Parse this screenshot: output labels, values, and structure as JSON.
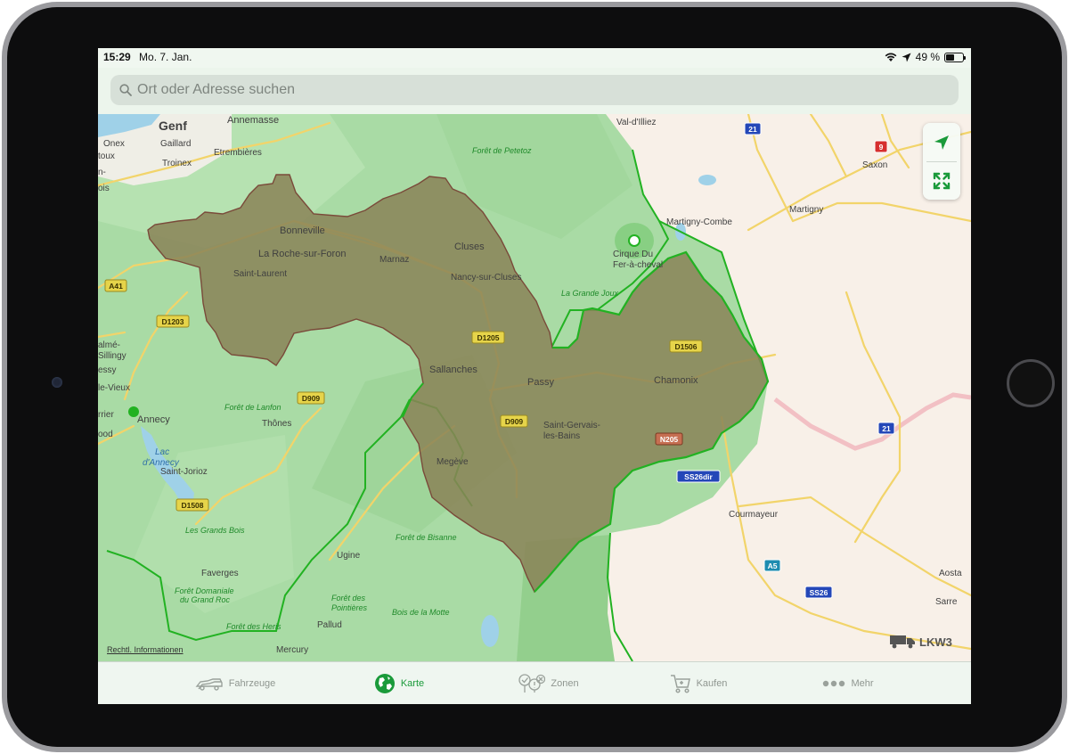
{
  "status": {
    "time": "15:29",
    "date": "Mo. 7. Jan.",
    "battery": "49 %",
    "battery_level": 0.49
  },
  "search": {
    "placeholder": "Ort oder Adresse suchen",
    "value": ""
  },
  "map": {
    "zone_fill": "#8a8257",
    "zone_stroke": "#7a4a3a",
    "border_green": "#22b222",
    "france_fill": "#a9dba5",
    "foreign_fill": "#f8f0e8",
    "cities": [
      {
        "name": "Genf"
      },
      {
        "name": "Annemasse"
      },
      {
        "name": "Onex"
      },
      {
        "name": "Gaillard"
      },
      {
        "name": "Troinex"
      },
      {
        "name": "Etrembières"
      },
      {
        "name": "Bonneville"
      },
      {
        "name": "La Roche-sur-Foron"
      },
      {
        "name": "Marnaz"
      },
      {
        "name": "Cluses"
      },
      {
        "name": "Saint-Laurent"
      },
      {
        "name": "Nancy-sur-Cluses"
      },
      {
        "name": "Sallanches"
      },
      {
        "name": "Passy"
      },
      {
        "name": "Chamonix"
      },
      {
        "name": "Saint-Gervais-"
      },
      {
        "name": "les-Bains"
      },
      {
        "name": "Megève"
      },
      {
        "name": "Annecy"
      },
      {
        "name": "Thônes"
      },
      {
        "name": "Saint-Jorioz"
      },
      {
        "name": "Faverges"
      },
      {
        "name": "Ugine"
      },
      {
        "name": "Pallud"
      },
      {
        "name": "Mercury"
      },
      {
        "name": "Val-d'Illiez"
      },
      {
        "name": "Saxon"
      },
      {
        "name": "Martigny"
      },
      {
        "name": "Martigny-Combe"
      },
      {
        "name": "Courmayeur"
      },
      {
        "name": "Aosta"
      },
      {
        "name": "Sarre"
      },
      {
        "name": "Cirque Du"
      },
      {
        "name": "Fer-à-cheval"
      },
      {
        "name": "almé-"
      },
      {
        "name": "Sillingy"
      },
      {
        "name": "essy"
      },
      {
        "name": "le-Vieux"
      },
      {
        "name": "rrier"
      },
      {
        "name": "ood"
      },
      {
        "name": "toux"
      },
      {
        "name": "n-"
      },
      {
        "name": "ois"
      }
    ],
    "forests": [
      {
        "name": "Forêt de Petetoz"
      },
      {
        "name": "La Grande Joux"
      },
      {
        "name": "Forêt de Lanfon"
      },
      {
        "name": "Les Grands Bois"
      },
      {
        "name": "Forêt de Bisanne"
      },
      {
        "name": "Forêt Domaniale"
      },
      {
        "name": "du Grand Roc"
      },
      {
        "name": "Forêt des"
      },
      {
        "name": "Pointières"
      },
      {
        "name": "Bois de la Motte"
      },
      {
        "name": "Forêt des Heris"
      }
    ],
    "water": [
      {
        "name": "Lac"
      },
      {
        "name": "d'Annecy"
      }
    ],
    "roads": [
      {
        "label": "A41"
      },
      {
        "label": "D1203"
      },
      {
        "label": "D1205"
      },
      {
        "label": "D1506"
      },
      {
        "label": "D909"
      },
      {
        "label": "D909"
      },
      {
        "label": "N205"
      },
      {
        "label": "D1508"
      },
      {
        "label": "SS26dir"
      },
      {
        "label": "A5"
      },
      {
        "label": "SS26"
      },
      {
        "label": "21"
      },
      {
        "label": "21"
      },
      {
        "label": "9"
      }
    ]
  },
  "legal_link": "Rechtl. Informationen",
  "brand": "LKW3",
  "tabs": [
    {
      "label": "Fahrzeuge",
      "icon": "trucks-icon",
      "active": false
    },
    {
      "label": "Karte",
      "icon": "globe-icon",
      "active": true
    },
    {
      "label": "Zonen",
      "icon": "zones-icon",
      "active": false
    },
    {
      "label": "Kaufen",
      "icon": "cart-icon",
      "active": false
    },
    {
      "label": "Mehr",
      "icon": "more-icon",
      "active": false
    }
  ],
  "colors": {
    "accent": "#1a9a3a",
    "tab_inactive": "#8f9690"
  }
}
